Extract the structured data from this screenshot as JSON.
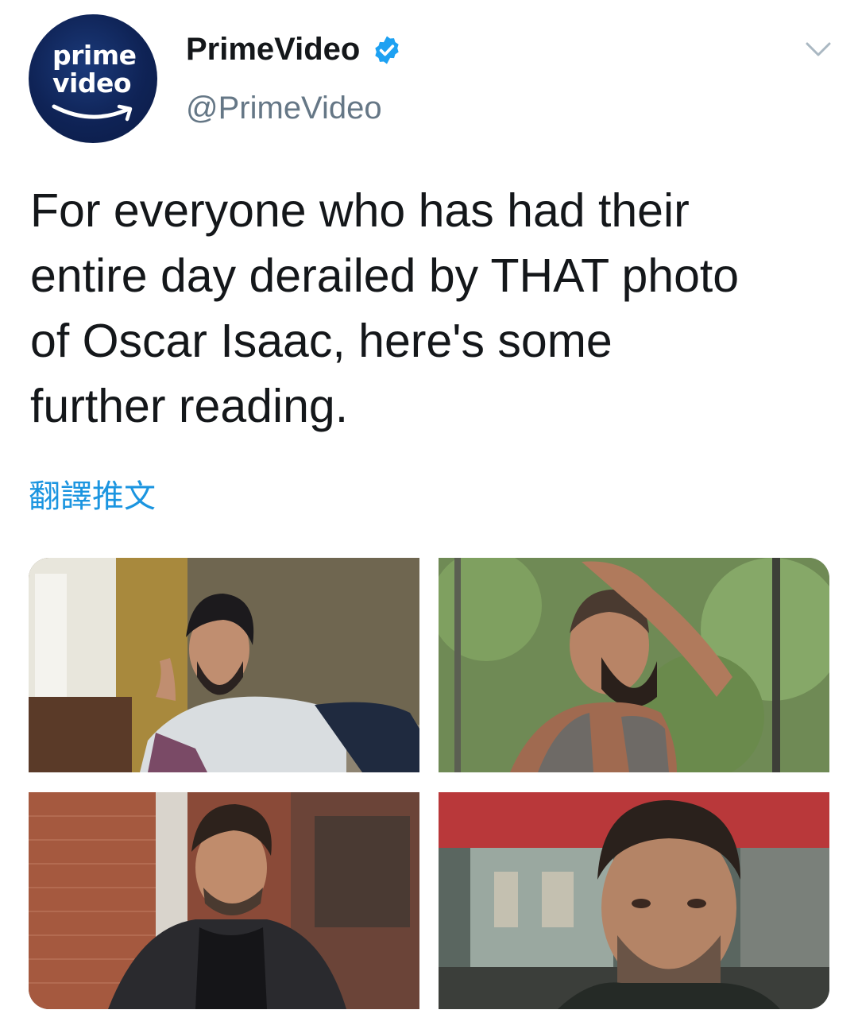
{
  "account": {
    "avatar_logo_line1": "prime",
    "avatar_logo_line2": "video",
    "display_name": "PrimeVideo",
    "handle": "@PrimeVideo",
    "verified": true
  },
  "icons": {
    "verified": "verified-badge-icon",
    "menu": "chevron-down-icon"
  },
  "tweet": {
    "text_lines": [
      "For everyone who has had their",
      "entire day derailed by THAT photo",
      "of Oscar Isaac, here's some",
      "further reading."
    ],
    "translate_label": "翻譯推文"
  },
  "colors": {
    "link_blue": "#1b95e0",
    "verified_blue": "#1da1f2",
    "handle_gray": "#657786",
    "text": "#14171a"
  }
}
